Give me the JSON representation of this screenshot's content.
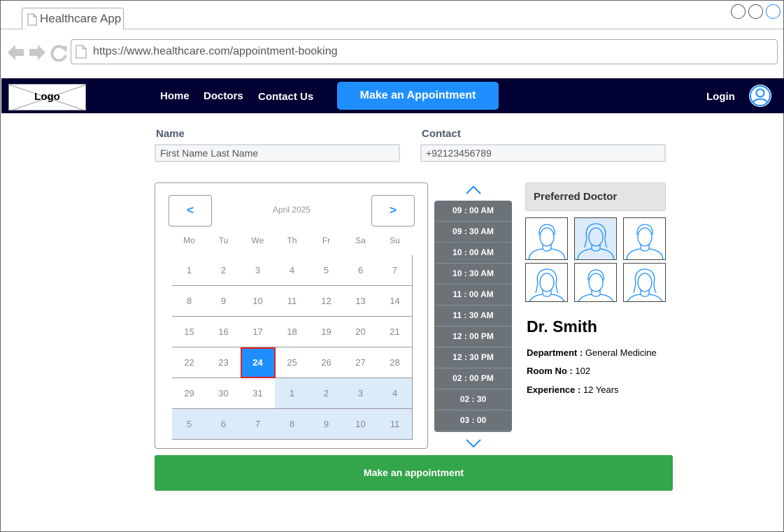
{
  "browser": {
    "tab_title": "Healthcare App",
    "url": "https://www.healthcare.com/appointment-booking"
  },
  "navbar": {
    "logo": "Logo",
    "links": [
      "Home",
      "Doctors",
      "Contact Us"
    ],
    "cta": "Make an Appointment",
    "login": "Login"
  },
  "form": {
    "name_label": "Name",
    "name_placeholder": "First Name Last Name",
    "contact_label": "Contact",
    "contact_placeholder": "+92123456789"
  },
  "calendar": {
    "month": "April 2025",
    "prev": "<",
    "next": ">",
    "weekdays": [
      "Mo",
      "Tu",
      "We",
      "Th",
      "Fr",
      "Sa",
      "Su"
    ],
    "days": [
      "1",
      "2",
      "3",
      "4",
      "5",
      "6",
      "7",
      "8",
      "9",
      "10",
      "11",
      "12",
      "13",
      "14",
      "15",
      "16",
      "17",
      "18",
      "19",
      "20",
      "21",
      "22",
      "23",
      "24",
      "25",
      "26",
      "27",
      "28",
      "29",
      "30",
      "31",
      "1",
      "2",
      "3",
      "4",
      "5",
      "6",
      "7",
      "8",
      "9",
      "10",
      "11"
    ],
    "selected": "24",
    "next_month_from_index": 31
  },
  "time_slots": [
    "09 : 00 AM",
    "09 : 30 AM",
    "10 : 00 AM",
    "10 : 30 AM",
    "11 : 00 AM",
    "11 : 30 AM",
    "12 : 00 PM",
    "12 : 30 PM",
    "02 : 00 PM",
    "02 : 30",
    "03 : 00"
  ],
  "doctor": {
    "section_title": "Preferred Doctor",
    "selected_index": 1,
    "name": "Dr. Smith",
    "department_label": "Department :",
    "department": "General Medicine",
    "room_label": "Room No :",
    "room": "102",
    "experience_label": "Experience :",
    "experience": "12 Years"
  },
  "submit_label": "Make an appointment",
  "colors": {
    "navbar": "#000033",
    "accent": "#1f8fff",
    "submit": "#33a54a",
    "slot_bg": "#6b7378",
    "selected_day_border": "#e02020"
  },
  "icons": [
    "doc-icon",
    "back-arrow-icon",
    "forward-arrow-icon",
    "refresh-icon",
    "user-icon",
    "chevron-up-icon",
    "chevron-down-icon",
    "doctor-avatar-icon"
  ]
}
